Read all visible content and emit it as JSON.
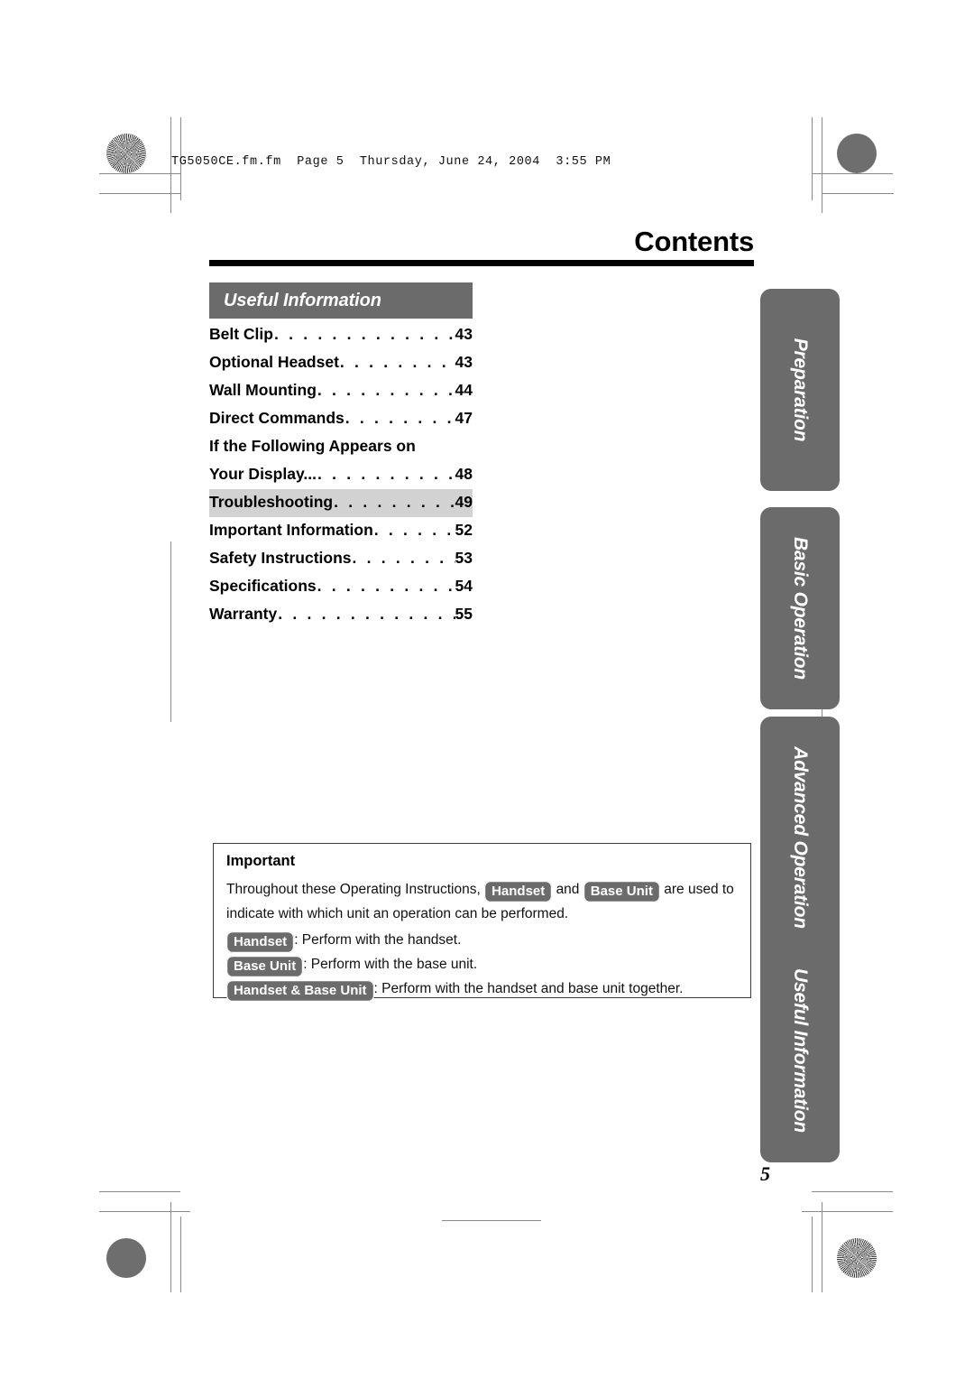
{
  "document": {
    "file_header": "TG5050CE.fm.fm  Page 5  Thursday, June 24, 2004  3:55 PM",
    "page_title": "Contents",
    "page_number": "5"
  },
  "section": {
    "header": "Useful Information"
  },
  "toc": {
    "entries": [
      {
        "label": "Belt Clip",
        "page": "43",
        "highlight": false,
        "leader": true
      },
      {
        "label": "Optional Headset",
        "page": "43",
        "highlight": false,
        "leader": true
      },
      {
        "label": "Wall Mounting",
        "page": "44",
        "highlight": false,
        "leader": true
      },
      {
        "label": "Direct Commands",
        "page": "47",
        "highlight": false,
        "leader": true
      },
      {
        "label": "If the Following Appears on",
        "label2": "Your Display...",
        "page": "48",
        "highlight": false,
        "leader": true
      },
      {
        "label": "Troubleshooting",
        "page": "49",
        "highlight": true,
        "leader": true
      },
      {
        "label": "Important Information",
        "page": "52",
        "highlight": false,
        "leader": true
      },
      {
        "label": "Safety Instructions",
        "page": "53",
        "highlight": false,
        "leader": true
      },
      {
        "label": "Specifications",
        "page": "54",
        "highlight": false,
        "leader": true
      },
      {
        "label": "Warranty",
        "page": "55",
        "highlight": false,
        "leader": true
      }
    ],
    "leader_dots": ". . . . . . . . . . . . . . . . . . . . . . . . . . . . . . . . . . . . . . . ."
  },
  "important": {
    "title": "Important",
    "lead_part1": "Throughout these Operating Instructions,",
    "badge_handset": "Handset",
    "lead_and": "and",
    "badge_base_unit": "Base Unit",
    "lead_part2": "are used to indicate with which unit an operation can be performed.",
    "lines": [
      {
        "badge": "Handset",
        "text": ": Perform with the handset."
      },
      {
        "badge": "Base Unit",
        "text": ": Perform with the base unit."
      },
      {
        "badge": "Handset & Base Unit",
        "text": ": Perform with the handset and base unit together."
      }
    ]
  },
  "side_tabs": [
    {
      "label": "Preparation"
    },
    {
      "label": "Basic Operation"
    },
    {
      "label": "Advanced Operation"
    },
    {
      "label": "Useful Information"
    }
  ],
  "colors": {
    "gray_bar": "#6b6b6b",
    "highlight": "#d2d2d2",
    "rule": "#000000"
  }
}
